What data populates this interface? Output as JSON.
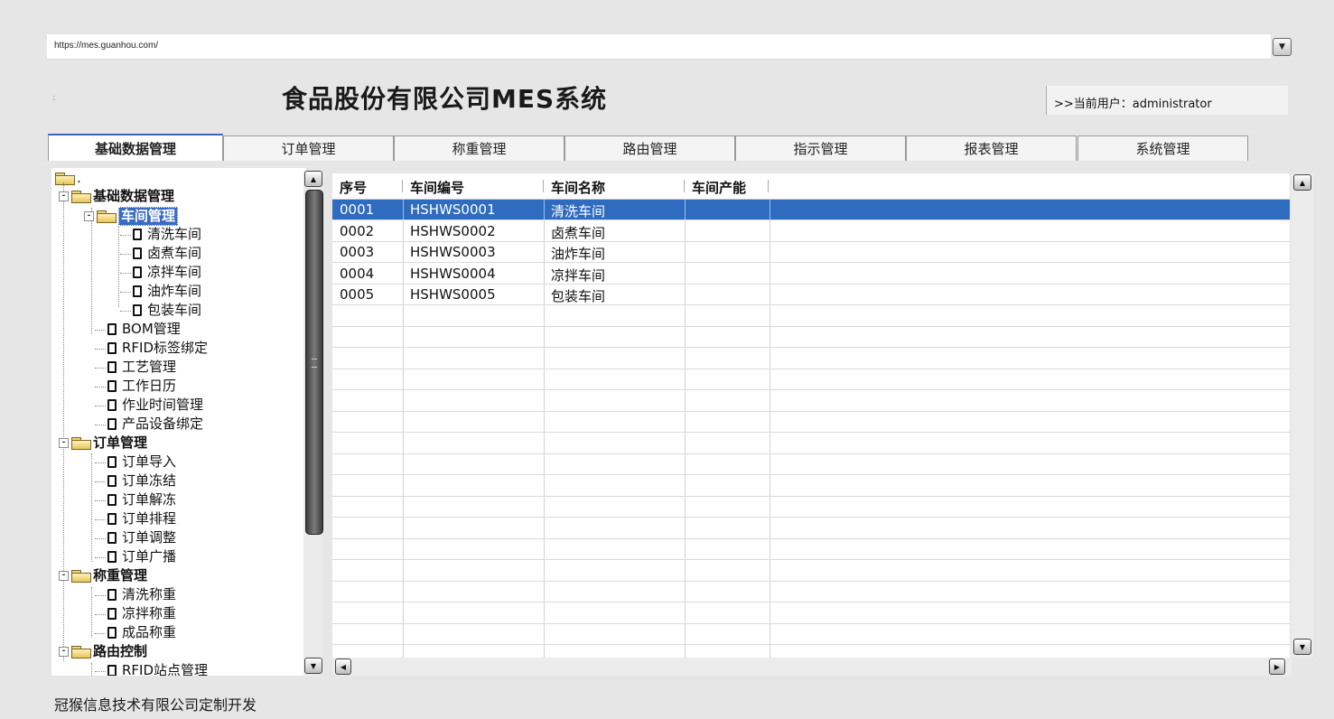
{
  "browser": {
    "url": "https://mes.guanhou.com/"
  },
  "app": {
    "title": "食品股份有限公司MES系统",
    "current_user": ">>当前用户：administrator",
    "marker": ":"
  },
  "tabs": [
    {
      "label": "基础数据管理",
      "active": true
    },
    {
      "label": "订单管理"
    },
    {
      "label": "称重管理"
    },
    {
      "label": "路由管理"
    },
    {
      "label": "指示管理"
    },
    {
      "label": "报表管理"
    },
    {
      "label": "系统管理"
    }
  ],
  "tree": {
    "root": ".",
    "items": [
      {
        "label": "基础数据管理",
        "type": "folder",
        "expander": "-"
      },
      {
        "label": "车间管理",
        "type": "folder",
        "expander": "-",
        "selected": true
      },
      {
        "label": "清洗车间",
        "type": "doc"
      },
      {
        "label": "卤煮车间",
        "type": "doc"
      },
      {
        "label": "凉拌车间",
        "type": "doc"
      },
      {
        "label": "油炸车间",
        "type": "doc"
      },
      {
        "label": "包装车间",
        "type": "doc"
      },
      {
        "label": "BOM管理",
        "type": "doc"
      },
      {
        "label": "RFID标签绑定",
        "type": "doc"
      },
      {
        "label": "工艺管理",
        "type": "doc"
      },
      {
        "label": "工作日历",
        "type": "doc"
      },
      {
        "label": "作业时间管理",
        "type": "doc"
      },
      {
        "label": "产品设备绑定",
        "type": "doc"
      },
      {
        "label": "订单管理",
        "type": "folder",
        "expander": "-"
      },
      {
        "label": "订单导入",
        "type": "doc"
      },
      {
        "label": "订单冻结",
        "type": "doc"
      },
      {
        "label": "订单解冻",
        "type": "doc"
      },
      {
        "label": "订单排程",
        "type": "doc"
      },
      {
        "label": "订单调整",
        "type": "doc"
      },
      {
        "label": "订单广播",
        "type": "doc"
      },
      {
        "label": "称重管理",
        "type": "folder",
        "expander": "-"
      },
      {
        "label": "清洗称重",
        "type": "doc"
      },
      {
        "label": "凉拌称重",
        "type": "doc"
      },
      {
        "label": "成品称重",
        "type": "doc"
      },
      {
        "label": "路由控制",
        "type": "folder",
        "expander": "-"
      },
      {
        "label": "RFID站点管理",
        "type": "doc"
      }
    ]
  },
  "grid": {
    "columns": [
      "序号",
      "车间编号",
      "车间名称",
      "车间产能"
    ],
    "rows": [
      [
        "0001",
        "HSHWS0001",
        "清洗车间",
        ""
      ],
      [
        "0002",
        "HSHWS0002",
        "卤煮车间",
        ""
      ],
      [
        "0003",
        "HSHWS0003",
        "油炸车间",
        ""
      ],
      [
        "0004",
        "HSHWS0004",
        "凉拌车间",
        ""
      ],
      [
        "0005",
        "HSHWS0005",
        "包装车间",
        ""
      ]
    ],
    "selected_row": 0
  },
  "icons": {
    "scroll_up": "scroll-up-icon",
    "scroll_down": "scroll-down-icon",
    "scroll_left": "scroll-left-icon",
    "scroll_right": "scroll-right-icon",
    "dropdown": "chevron-down-icon",
    "folder": "folder-icon",
    "document": "document-icon"
  },
  "colors": {
    "selection": "#2f6cc0",
    "active_tab_border": "#3a64b4"
  },
  "footer": {
    "text": "冠猴信息技术有限公司定制开发"
  }
}
